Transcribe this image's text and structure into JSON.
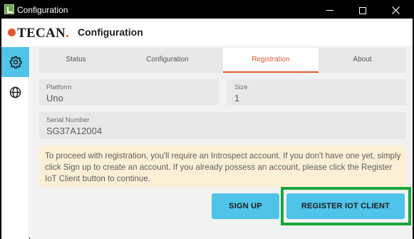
{
  "window": {
    "title": "Configuration",
    "controls": {
      "minimize": "minimize-icon",
      "maximize": "maximize-icon",
      "close": "close-icon"
    }
  },
  "header": {
    "logo_text": "TECAN",
    "logo_period": ".",
    "title": "Configuration"
  },
  "sidebar": {
    "items": [
      {
        "icon": "gear-icon",
        "active": true
      },
      {
        "icon": "globe-icon",
        "active": false
      }
    ]
  },
  "tabs": [
    {
      "label": "Status",
      "active": false
    },
    {
      "label": "Configuration",
      "active": false
    },
    {
      "label": "Registration",
      "active": true
    },
    {
      "label": "About",
      "active": false
    }
  ],
  "fields": {
    "platform": {
      "label": "Platform",
      "value": "Uno"
    },
    "size": {
      "label": "Size",
      "value": "1"
    },
    "serial": {
      "label": "Serial Number",
      "value": "SG37A12004"
    }
  },
  "notice": "To proceed with registration, you'll require an Introspect account. If you don't have one yet, simply click Sign up to create an account. If you already possess an account, please click the Register IoT Client button to continue.",
  "buttons": {
    "sign_up": "SIGN UP",
    "register": "REGISTER IOT CLIENT"
  },
  "colors": {
    "accent": "#4fc3e8",
    "brand": "#e4572e",
    "highlight": "#1aa63a",
    "notice_bg": "#fbf0d6"
  }
}
